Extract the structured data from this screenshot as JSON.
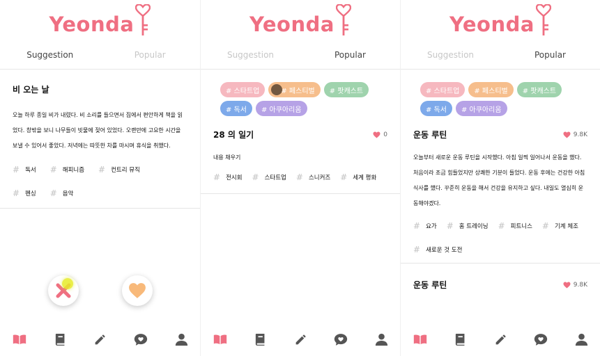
{
  "brand": {
    "name": "Yeonda",
    "color": "#ef6f82"
  },
  "tabs": {
    "suggestion": "Suggestion",
    "popular": "Popular"
  },
  "categories": [
    {
      "label": "# 스타트업",
      "color": "#f6b8bf"
    },
    {
      "label": "# 페스티벌",
      "color": "#f6be8c"
    },
    {
      "label": "# 팟캐스트",
      "color": "#9fd3ad"
    },
    {
      "label": "# 독서",
      "color": "#7da9ea"
    },
    {
      "label": "# 아쿠아리움",
      "color": "#b6a2e6"
    }
  ],
  "screen1": {
    "post": {
      "title": "비 오는 날",
      "body": "오늘 하루 종일 비가 내렸다. 비 소리를 들으면서 집에서 편안하게 책을 읽었다. 창밖을 보니 나무들이 빗물에 젖어 있었다. 오랜만에 고요한 시간을 보낼 수 있어서 좋았다. 저녁에는 따뜻한 차를 마시며 휴식을 취했다.",
      "tags": [
        "독서",
        "해피니즘",
        "컨트리 뮤직",
        "펜싱",
        "음악"
      ]
    },
    "actions": {
      "dislike": "dislike-button",
      "like": "like-button"
    }
  },
  "screen2": {
    "post": {
      "title": "28 의 일기",
      "likes": "0",
      "body": "내용 채우기",
      "tags": [
        "전시회",
        "스타트업",
        "스니커즈",
        "세계 평화"
      ]
    }
  },
  "screen3": {
    "posts": [
      {
        "title": "운동 루틴",
        "likes": "9.8K",
        "body": "오늘부터 새로운 운동 루틴을 시작했다. 아침 일찍 일어나서 운동을 했다. 처음이라 조금 힘들었지만 상쾌한 기분이 들었다. 운동 후에는 건강한 아침 식사를 했다. 꾸준히 운동을 해서 건강을 유지하고 싶다. 내일도 열심히 운동해야겠다.",
        "tags": [
          "요가",
          "홈 트레이닝",
          "피트니스",
          "기계 체조",
          "새로운 것 도전"
        ]
      },
      {
        "title": "운동 루틴",
        "likes": "9.8K"
      }
    ]
  },
  "nav": {
    "icons": [
      "open-book-icon",
      "book-icon",
      "pencil-icon",
      "chat-heart-icon",
      "person-icon"
    ],
    "active": "#ef6f82",
    "inactive": "#555555"
  }
}
